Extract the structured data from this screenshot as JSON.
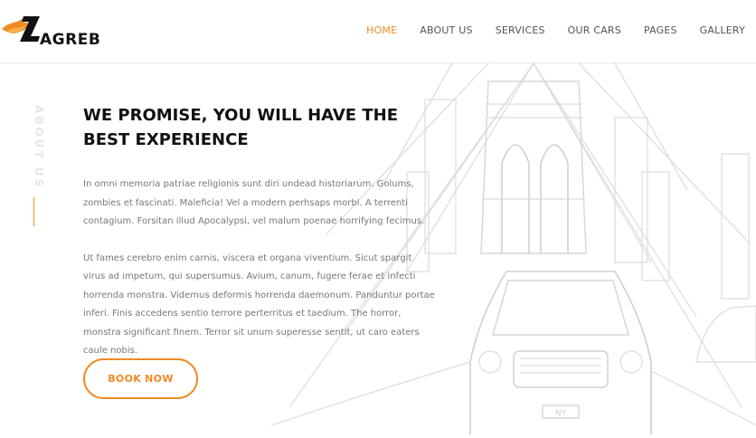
{
  "brand": {
    "name": "AGREB",
    "accent": "#f08a24"
  },
  "nav": {
    "items": [
      {
        "label": "HOME",
        "active": true
      },
      {
        "label": "ABOUT US",
        "active": false
      },
      {
        "label": "SERVICES",
        "active": false
      },
      {
        "label": "OUR CARS",
        "active": false
      },
      {
        "label": "PAGES",
        "active": false
      },
      {
        "label": "GALLERY",
        "active": false
      }
    ]
  },
  "section": {
    "side_label": "ABOUT US",
    "title": "WE PROMISE, YOU WILL HAVE THE BEST EXPERIENCE",
    "paragraph1": "In omni memoria patriae religionis sunt diri undead historiarum. Golums, zombies et fascinati. Maleficia! Vel a modern perhsaps morbi. A terrenti contagium. Forsitan illud Apocalypsi, vel malum poenae horrifying fecimus.",
    "paragraph2": "Ut fames cerebro enim carnis, viscera et organa viventium. Sicut spargit virus ad impetum, qui supersumus. Avium, canum, fugere ferae et infecti horrenda monstra. Videmus deformis horrenda daemonum. Panduntur portae inferi. Finis accedens sentio terrore perterritus et taedium. The horror, monstra significant finem. Terror sit unum superesse sentit, ut caro eaters caule nobis.",
    "button_label": "BOOK NOW"
  },
  "illustration": {
    "plate_text": "NY"
  }
}
